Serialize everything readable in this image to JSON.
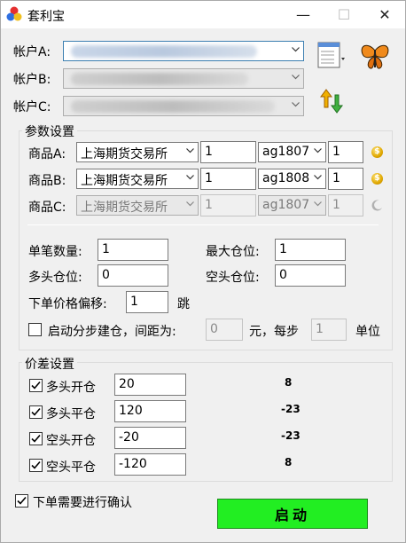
{
  "window": {
    "title": "套利宝",
    "min_glyph": "—",
    "max_glyph": "☐",
    "close_glyph": "✕"
  },
  "accounts": {
    "a_label": "帐户A:",
    "b_label": "帐户B:",
    "c_label": "帐户C:"
  },
  "params": {
    "group_title": "参数设置",
    "products": [
      {
        "label": "商品A:",
        "exchange": "上海期货交易所",
        "qty": "1",
        "contract": "ag1807",
        "ratio": "1",
        "enabled": true
      },
      {
        "label": "商品B:",
        "exchange": "上海期货交易所",
        "qty": "1",
        "contract": "ag1808",
        "ratio": "1",
        "enabled": true
      },
      {
        "label": "商品C:",
        "exchange": "上海期货交易所",
        "qty": "1",
        "contract": "ag1807",
        "ratio": "1",
        "enabled": false
      }
    ],
    "single_qty_label": "单笔数量:",
    "single_qty": "1",
    "max_pos_label": "最大仓位:",
    "max_pos": "1",
    "long_pos_label": "多头仓位:",
    "long_pos": "0",
    "short_pos_label": "空头仓位:",
    "short_pos": "0",
    "offset_label": "下单价格偏移:",
    "offset": "1",
    "offset_unit": "跳",
    "step_label": "启动分步建仓，间距为:",
    "step_gap": "0",
    "step_unit1": "元，每步",
    "step_size": "1",
    "step_unit2": "单位"
  },
  "spread": {
    "group_title": "价差设置",
    "rows": [
      {
        "label": "多头开仓",
        "checked": true,
        "value": "20",
        "live": "8"
      },
      {
        "label": "多头平仓",
        "checked": true,
        "value": "120",
        "live": "-23"
      },
      {
        "label": "空头开仓",
        "checked": true,
        "value": "-20",
        "live": "-23"
      },
      {
        "label": "空头平仓",
        "checked": true,
        "value": "-120",
        "live": "8"
      }
    ]
  },
  "confirm_label": "下单需要进行确认",
  "start_label": "启动",
  "colors": {
    "start_bg": "#22ee22",
    "focus_border": "#3c7fb1"
  }
}
